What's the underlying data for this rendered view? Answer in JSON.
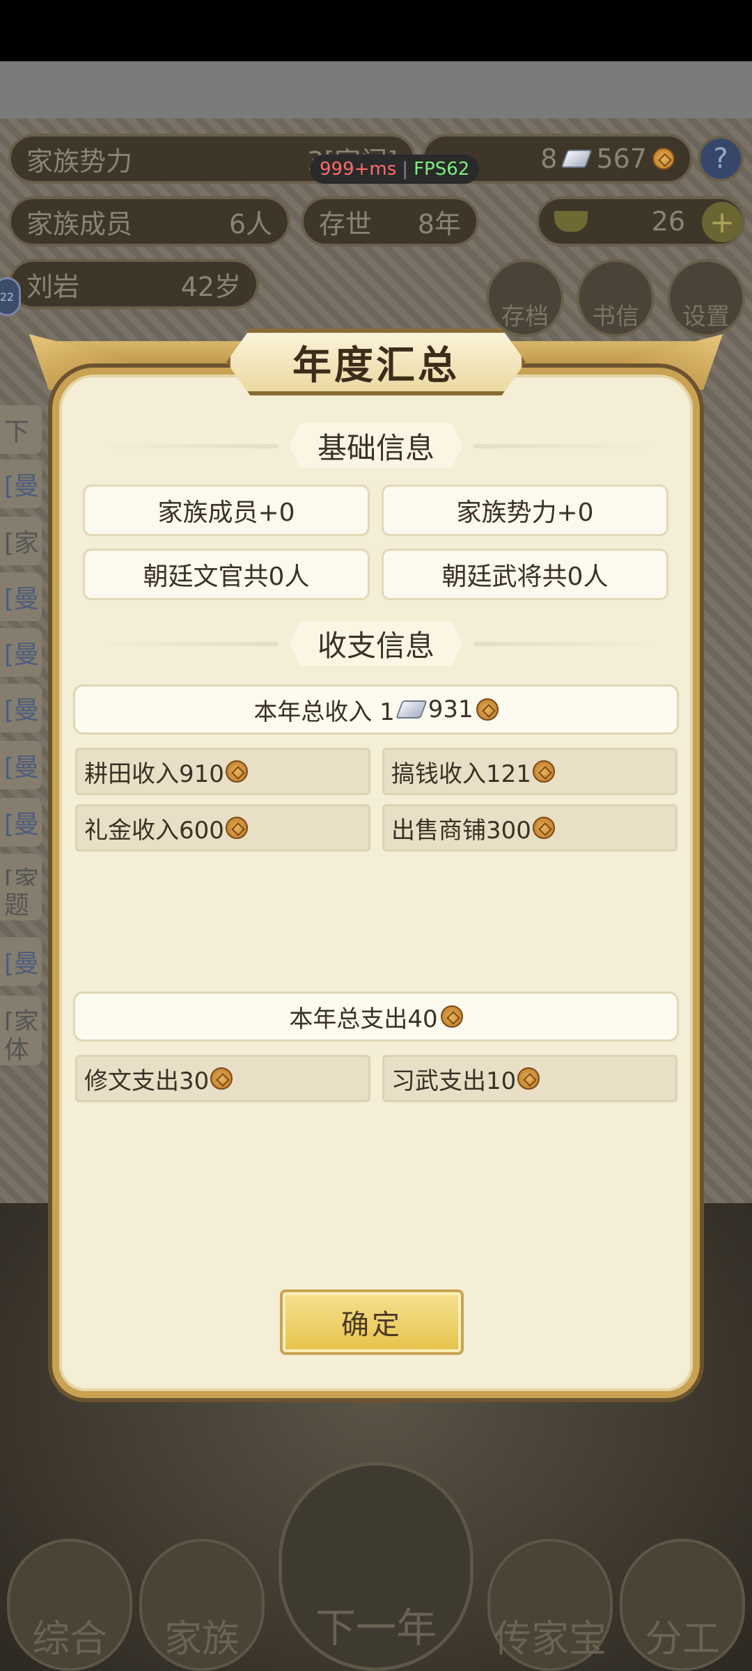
{
  "background": {
    "clan_power_label": "家族势力",
    "clan_power_value": "3",
    "clan_power_rank": "[家门]",
    "clan_members_label": "家族成员",
    "clan_members_value": "6人",
    "generation_label": "存世",
    "generation_value": "8年",
    "silver_count": "8",
    "copper_count": "567",
    "gold_count": "26",
    "leader_name": "刘岩",
    "leader_age": "42岁",
    "level_badge": "22",
    "save_button": "存档",
    "letter_button": "书信",
    "settings_button": "设置",
    "ping": "999+ms",
    "fps": "FPS62",
    "side_texts": [
      "下",
      "[曼",
      "[家",
      "[曼",
      "[曼",
      "[曼",
      "[曼",
      "[曼",
      "[家",
      "题",
      "[曼",
      "[家",
      "体"
    ],
    "nav": [
      "综合",
      "家族",
      "下一年",
      "传家宝",
      "分工"
    ]
  },
  "modal": {
    "title": "年度汇总",
    "basic_section": "基础信息",
    "basic_items": [
      "家族成员+0",
      "家族势力+0",
      "朝廷文官共0人",
      "朝廷武将共0人"
    ],
    "finance_section": "收支信息",
    "income_total_label": "本年总收入 1",
    "income_total_value": "931",
    "income_items": [
      {
        "label": "耕田收入910"
      },
      {
        "label": "搞钱收入121"
      },
      {
        "label": "礼金收入600"
      },
      {
        "label": "出售商铺300"
      }
    ],
    "expense_total_label": "本年总支出40",
    "expense_items": [
      {
        "label": "修文支出30"
      },
      {
        "label": "习武支出10"
      }
    ],
    "confirm": "确定"
  }
}
